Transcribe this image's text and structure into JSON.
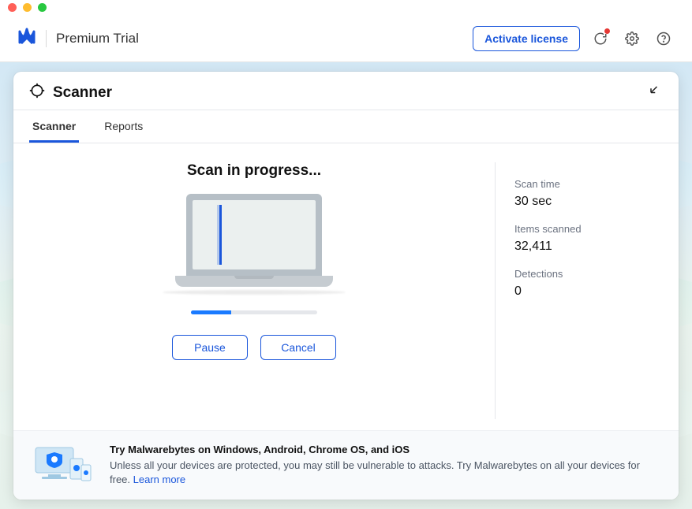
{
  "header": {
    "product_name": "Premium Trial",
    "activate_label": "Activate license"
  },
  "panel": {
    "title": "Scanner"
  },
  "tabs": [
    {
      "label": "Scanner",
      "active": true
    },
    {
      "label": "Reports",
      "active": false
    }
  ],
  "scan": {
    "heading": "Scan in progress...",
    "progress_percent": 32,
    "pause_label": "Pause",
    "cancel_label": "Cancel"
  },
  "stats": {
    "scan_time_label": "Scan time",
    "scan_time_value": "30 sec",
    "items_scanned_label": "Items scanned",
    "items_scanned_value": "32,411",
    "detections_label": "Detections",
    "detections_value": "0"
  },
  "promo": {
    "title": "Try Malwarebytes on Windows, Android, Chrome OS, and iOS",
    "body": "Unless all your devices are protected, you may still be vulnerable to attacks. Try Malwarebytes on all your devices for free. ",
    "link_label": "Learn more"
  },
  "colors": {
    "accent": "#1a56db"
  }
}
